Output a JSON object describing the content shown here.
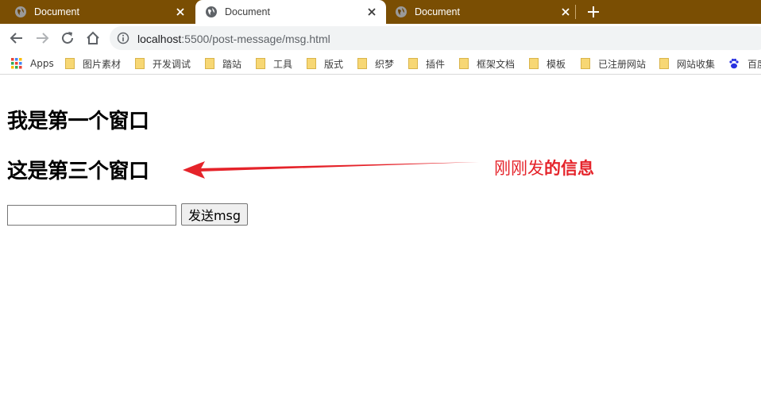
{
  "browser": {
    "tabs": [
      {
        "title": "Document",
        "active": false
      },
      {
        "title": "Document",
        "active": true
      },
      {
        "title": "Document",
        "active": false
      }
    ],
    "url_host": "localhost",
    "url_path": ":5500/post-message/msg.html",
    "bookmarks": [
      {
        "label": "Apps",
        "icon": "apps-grid-icon"
      },
      {
        "label": "图片素材",
        "icon": "folder-icon"
      },
      {
        "label": "开发调试",
        "icon": "folder-icon"
      },
      {
        "label": "踏站",
        "icon": "folder-icon"
      },
      {
        "label": "工具",
        "icon": "folder-icon"
      },
      {
        "label": "版式",
        "icon": "folder-icon"
      },
      {
        "label": "织梦",
        "icon": "folder-icon"
      },
      {
        "label": "插件",
        "icon": "folder-icon"
      },
      {
        "label": "框架文档",
        "icon": "folder-icon"
      },
      {
        "label": "模板",
        "icon": "folder-icon"
      },
      {
        "label": "已注册网站",
        "icon": "folder-icon"
      },
      {
        "label": "网站收集",
        "icon": "folder-icon"
      },
      {
        "label": "百度",
        "icon": "baidu-icon"
      }
    ],
    "colors": {
      "tab_strip": "#7a4e03",
      "omnibox": "#f1f3f4",
      "folder": "#f7d774"
    }
  },
  "page": {
    "heading_first": "我是第一个窗口",
    "heading_second": "这是第三个窗口",
    "input_value": "",
    "send_button": "发送msg"
  },
  "annotation": {
    "text_light": "刚刚发",
    "text_bold": "的信息",
    "color": "#e5232a"
  }
}
